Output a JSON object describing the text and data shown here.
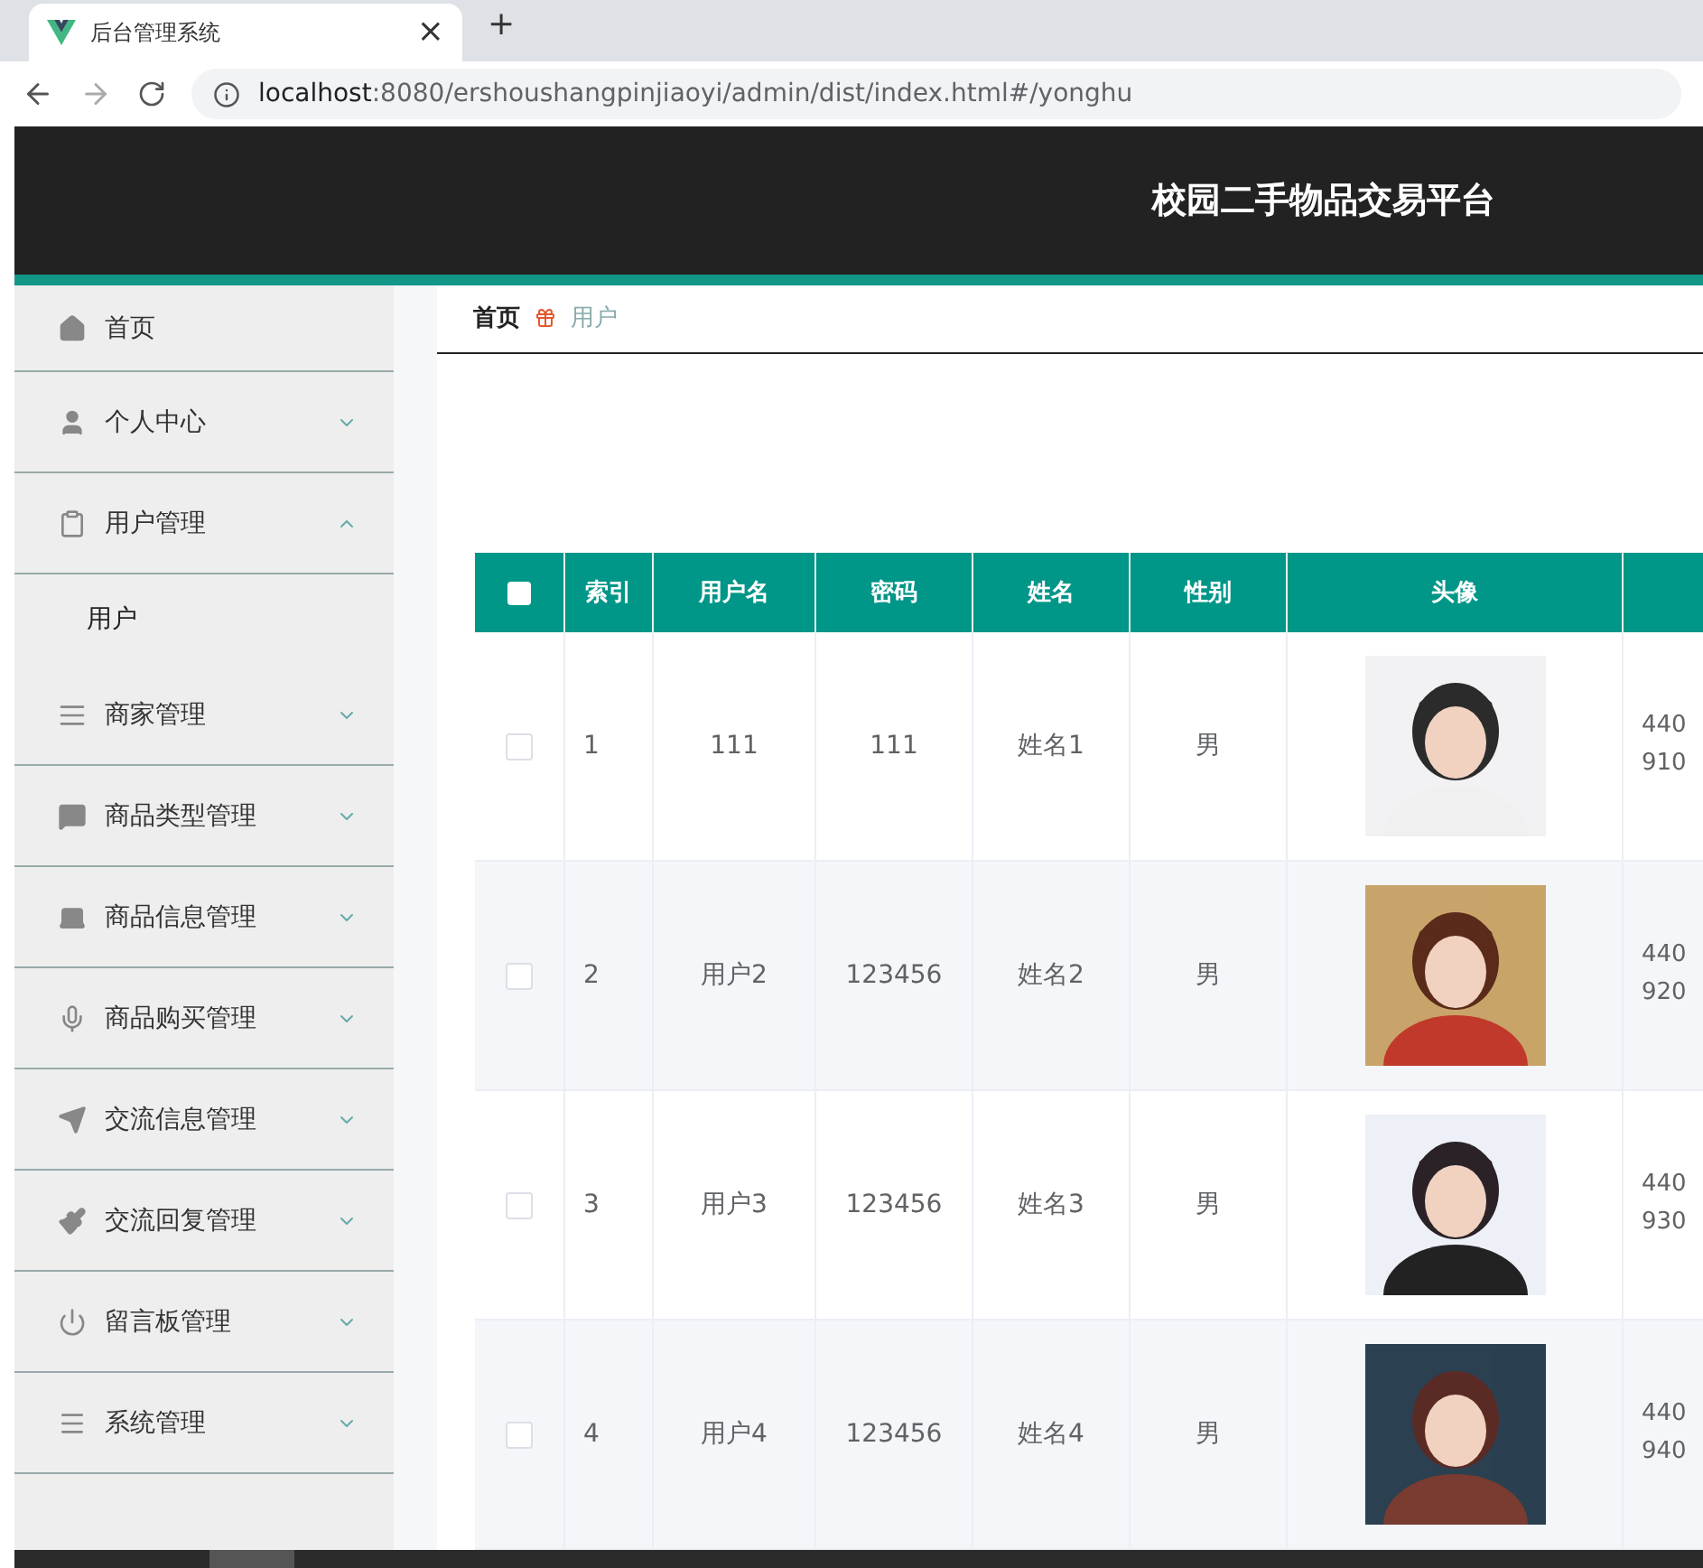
{
  "browser": {
    "tab_title": "后台管理系统",
    "close": "×",
    "new_tab": "+",
    "url_host": "localhost",
    "url_path": ":8080/ershoushangpinjiaoyi/admin/dist/index.html#/yonghu"
  },
  "header": {
    "title": "校园二手物品交易平台"
  },
  "sidebar": {
    "items": [
      {
        "label": "首页",
        "kind": "link"
      },
      {
        "label": "个人中心",
        "kind": "submenu",
        "expanded": false
      },
      {
        "label": "用户管理",
        "kind": "submenu",
        "expanded": true,
        "children": [
          {
            "label": "用户"
          }
        ]
      },
      {
        "label": "商家管理",
        "kind": "submenu",
        "expanded": false
      },
      {
        "label": "商品类型管理",
        "kind": "submenu",
        "expanded": false
      },
      {
        "label": "商品信息管理",
        "kind": "submenu",
        "expanded": false
      },
      {
        "label": "商品购买管理",
        "kind": "submenu",
        "expanded": false
      },
      {
        "label": "交流信息管理",
        "kind": "submenu",
        "expanded": false
      },
      {
        "label": "交流回复管理",
        "kind": "submenu",
        "expanded": false
      },
      {
        "label": "留言板管理",
        "kind": "submenu",
        "expanded": false
      },
      {
        "label": "系统管理",
        "kind": "submenu",
        "expanded": false
      }
    ]
  },
  "breadcrumb": [
    {
      "label": "首页",
      "selected": false
    },
    {
      "label": "用户",
      "selected": true
    }
  ],
  "table": {
    "all_checked": false,
    "columns": [
      "索引",
      "用户名",
      "密码",
      "姓名",
      "性别",
      "头像"
    ],
    "rows": [
      {
        "checked": false,
        "cells": [
          "1",
          "111",
          "111",
          "姓名1",
          "男"
        ],
        "avatar": {
          "kind": "picture"
        },
        "column_8": [
          "440",
          "910"
        ]
      },
      {
        "checked": false,
        "cells": [
          "2",
          "用户2",
          "123456",
          "姓名2",
          "男"
        ],
        "avatar": {
          "kind": "picture"
        },
        "column_8": [
          "440",
          "920"
        ]
      },
      {
        "checked": false,
        "cells": [
          "3",
          "用户3",
          "123456",
          "姓名3",
          "男"
        ],
        "avatar": {
          "kind": "picture"
        },
        "column_8": [
          "440",
          "930"
        ]
      },
      {
        "checked": false,
        "cells": [
          "4",
          "用户4",
          "123456",
          "姓名4",
          "男"
        ],
        "avatar": {
          "kind": "picture"
        },
        "column_8": [
          "440",
          "940"
        ]
      }
    ]
  }
}
